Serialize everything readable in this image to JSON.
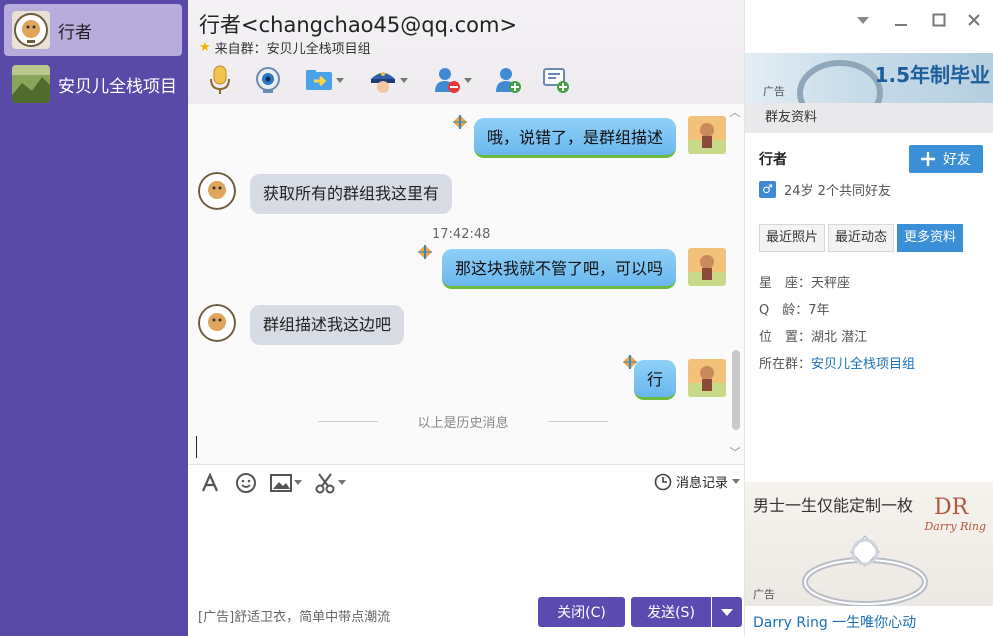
{
  "sidebar": {
    "conversations": [
      {
        "name": "行者",
        "active": true
      },
      {
        "name": "安贝儿全栈项目",
        "active": false
      }
    ]
  },
  "header": {
    "title": "行者<changchao45@qq.com>",
    "subtitle": "来自群：安贝儿全栈项目组",
    "toolbar_icons": [
      "voice-icon",
      "video-icon",
      "file-transfer-icon",
      "remote-assist-icon",
      "block-user-icon",
      "add-friend-icon",
      "message-manager-icon"
    ]
  },
  "chat": {
    "messages": [
      {
        "side": "out",
        "text": "哦，说错了，是群组描述"
      },
      {
        "side": "in",
        "text": "获取所有的群组我这里有"
      },
      {
        "side": "out",
        "text": "那这块我就不管了吧，可以吗",
        "time": "17:42:48"
      },
      {
        "side": "in",
        "text": "群组描述我这边吧"
      },
      {
        "side": "out",
        "text": "行"
      }
    ],
    "history_notice": "以上是历史消息"
  },
  "input": {
    "history_label": "消息记录",
    "ad_text": "[广告]舒适卫衣，简单中带点潮流",
    "close_label": "关闭(C)",
    "send_label": "发送(S)"
  },
  "window_controls": [
    "dropdown-icon",
    "minimize-icon",
    "maximize-icon",
    "close-icon"
  ],
  "profile": {
    "ad_top_text": "1.5年制毕业",
    "ad_label": "广告",
    "section_title": "群友资料",
    "name": "行者",
    "add_friend_label": "好友",
    "info": "24岁  2个共同好友",
    "tabs": [
      {
        "label": "最近照片",
        "active": false
      },
      {
        "label": "最近动态",
        "active": false
      },
      {
        "label": "更多资料",
        "active": true
      }
    ],
    "details": [
      {
        "label": "星　座：",
        "value": "天秤座",
        "link": false
      },
      {
        "label": "Q　龄：",
        "value": "7年",
        "link": false
      },
      {
        "label": "位　置：",
        "value": "湖北 潜江",
        "link": false
      },
      {
        "label": "所在群：",
        "value": "安贝儿全栈项目组",
        "link": true
      }
    ],
    "ad_bottom_headline": "男士一生仅能定制一枚",
    "ad_bottom_brand": "Darry Ring",
    "ad_bottom_caption": "Darry Ring 一生唯你心动"
  },
  "colors": {
    "sidebar_bg": "#5a4aa8",
    "active_item_bg": "#b7acdc",
    "button_primary": "#5b4ab0",
    "accent_blue": "#3a8fd6",
    "link_blue": "#1b6fb8"
  }
}
